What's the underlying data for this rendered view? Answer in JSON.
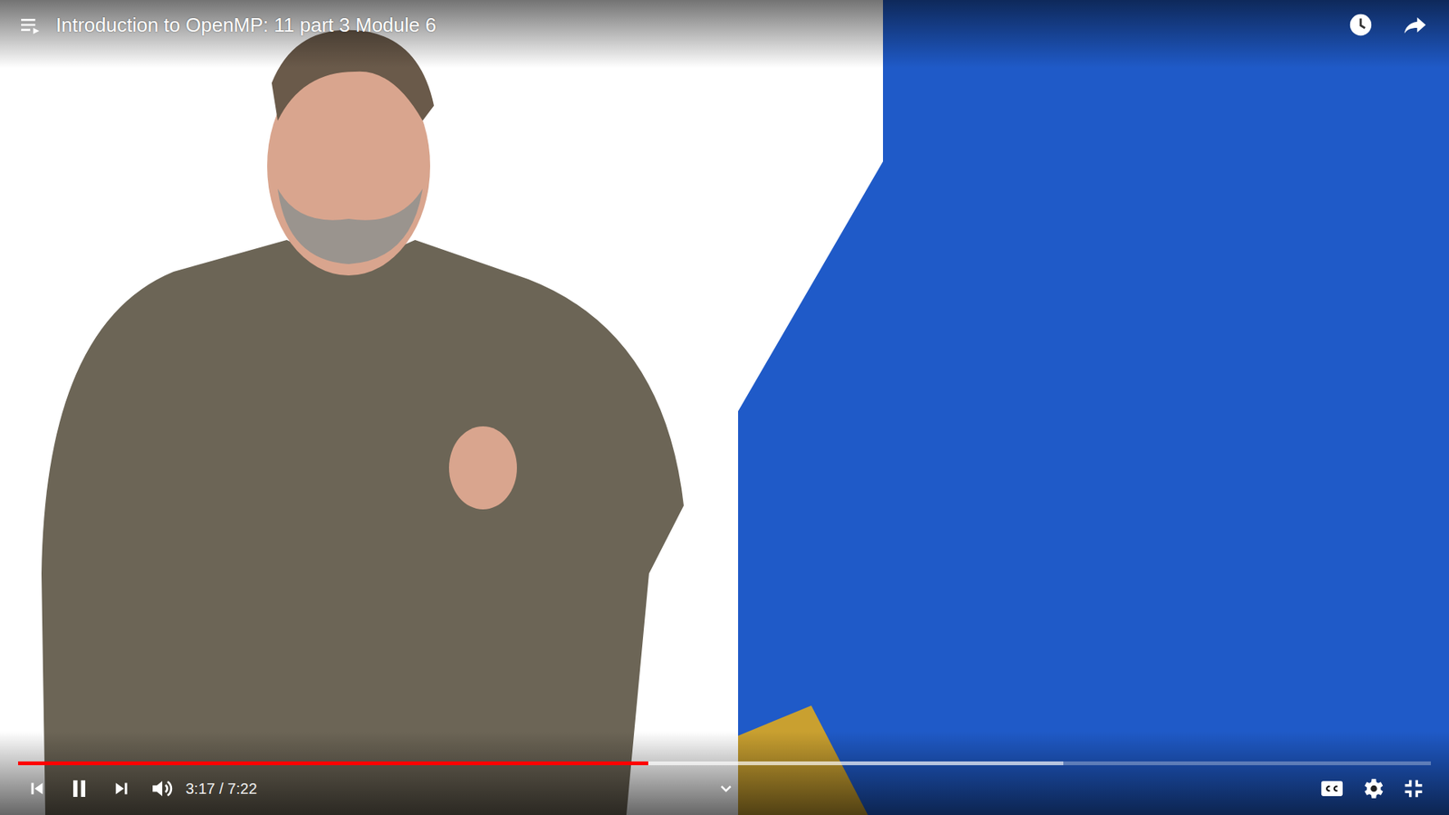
{
  "window": {
    "title": "Introduction to OpenMP: 11 part 3 Module 6"
  },
  "player": {
    "playing": true,
    "muted": false,
    "time": "3:17 / 7:22",
    "progress": {
      "level": 0.446
    },
    "buffered": {
      "level": 0.74
    }
  }
}
